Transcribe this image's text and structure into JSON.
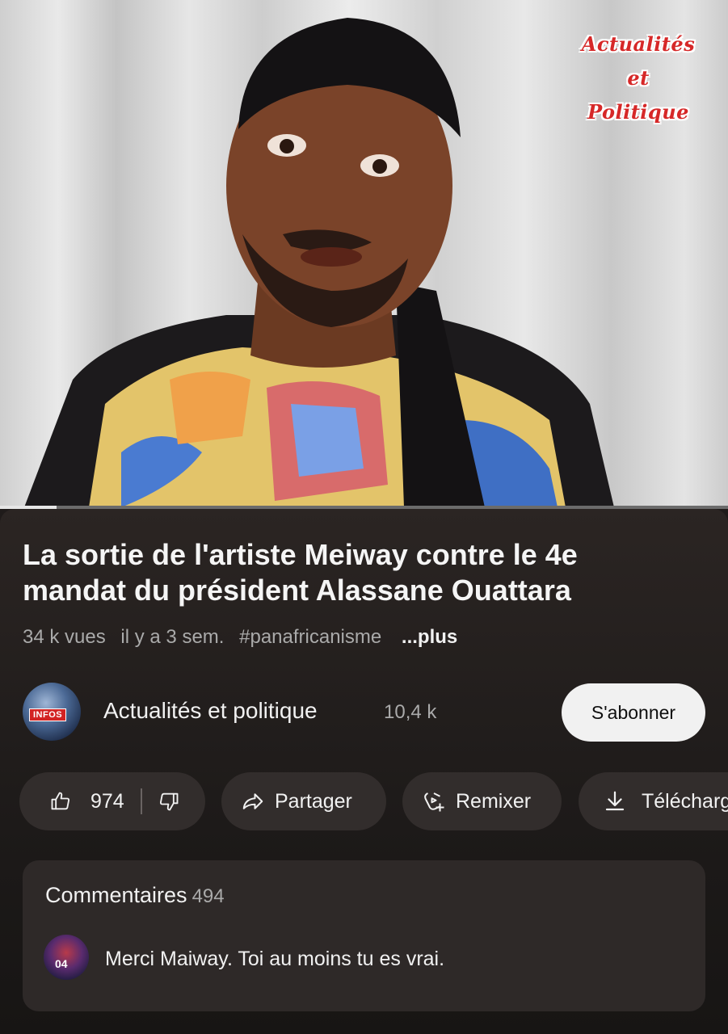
{
  "video": {
    "watermark": {
      "line1": "Actualités",
      "line2": "et",
      "line3": "Politique"
    },
    "progress_fraction": 0.078
  },
  "title": "La sortie de l'artiste Meiway contre le  4e\nmandat du président Alassane Ouattara",
  "meta": {
    "views": "34 k vues",
    "age": "il y a 3 sem.",
    "hashtag": "#panafricanisme",
    "more": "...plus"
  },
  "channel": {
    "avatar_tag": "INFOS",
    "name": "Actualités et politique",
    "subscribers": "10,4 k",
    "subscribe_label": "S'abonner"
  },
  "actions": {
    "likes": "974",
    "share_label": "Partager",
    "remix_label": "Remixer",
    "download_label": "Télécharger"
  },
  "comments": {
    "title": "Commentaires",
    "count": "494",
    "first_avatar_label": "04",
    "first_text": "Merci Maiway. Toi au moins tu es vrai."
  },
  "icons": [
    "thumbs-up-icon",
    "thumbs-down-icon",
    "share-icon",
    "remix-icon",
    "download-icon"
  ]
}
